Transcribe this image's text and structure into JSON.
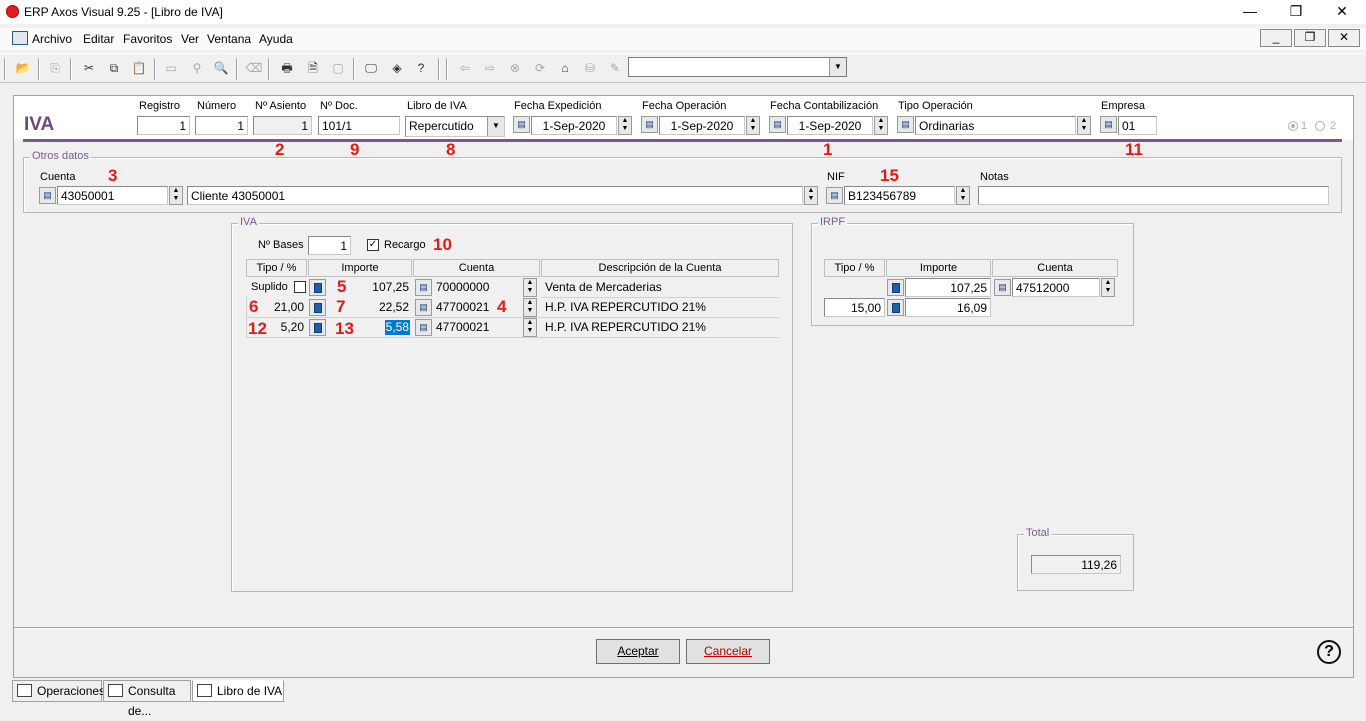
{
  "window": {
    "title": "ERP Axos Visual 9.25 - [Libro de IVA]"
  },
  "menu": [
    "Archivo",
    "Editar",
    "Favoritos",
    "Ver",
    "Ventana",
    "Ayuda"
  ],
  "form": {
    "title": "IVA",
    "registro": {
      "label": "Registro",
      "value": "1"
    },
    "numero": {
      "label": "Número",
      "value": "1"
    },
    "asiento": {
      "label": "Nº Asiento",
      "value": "1"
    },
    "doc": {
      "label": "Nº Doc.",
      "value": "101/1"
    },
    "libro": {
      "label": "Libro de IVA",
      "value": "Repercutido"
    },
    "fecha_exp": {
      "label": "Fecha Expedición",
      "value": "1-Sep-2020"
    },
    "fecha_op": {
      "label": "Fecha Operación",
      "value": "1-Sep-2020"
    },
    "fecha_cont": {
      "label": "Fecha Contabilización",
      "value": "1-Sep-2020"
    },
    "tipo_op": {
      "label": "Tipo Operación",
      "value": "Ordinarias"
    },
    "empresa": {
      "label": "Empresa",
      "value": "01"
    },
    "radio1": "1",
    "radio2": "2"
  },
  "otros": {
    "title": "Otros datos",
    "cuenta_label": "Cuenta",
    "cuenta": "43050001",
    "cliente": "Cliente 43050001",
    "nif_label": "NIF",
    "nif": "B123456789",
    "notas_label": "Notas",
    "notas": ""
  },
  "iva": {
    "title": "IVA",
    "bases_label": "Nº Bases",
    "bases": "1",
    "recargo_label": "Recargo",
    "headers": [
      "Tipo / %",
      "Importe",
      "Cuenta",
      "Descripción de la Cuenta"
    ],
    "suplido_label": "Suplido",
    "row0": {
      "importe": "107,25",
      "cuenta": "70000000",
      "desc": "Venta de Mercaderias"
    },
    "row1": {
      "tipo": "21,00",
      "importe": "22,52",
      "cuenta": "47700021",
      "desc": "H.P. IVA REPERCUTIDO 21%"
    },
    "row2": {
      "tipo": "5,20",
      "importe": "5,58",
      "cuenta": "47700021",
      "desc": "H.P. IVA REPERCUTIDO 21%"
    }
  },
  "irpf": {
    "title": "IRPF",
    "headers": [
      "Tipo / %",
      "Importe",
      "Cuenta"
    ],
    "row0": {
      "importe": "107,25",
      "cuenta": "47512000"
    },
    "row1": {
      "tipo": "15,00",
      "importe": "16,09"
    }
  },
  "total": {
    "title": "Total",
    "value": "119,26"
  },
  "buttons": {
    "aceptar": "Aceptar",
    "cancelar": "Cancelar"
  },
  "tabs": [
    "Operaciones",
    "Consulta de...",
    "Libro de IVA"
  ],
  "markers": {
    "m1": "1",
    "m2": "2",
    "m3": "3",
    "m4": "4",
    "m5": "5",
    "m6": "6",
    "m7": "7",
    "m8": "8",
    "m9": "9",
    "m10": "10",
    "m11": "11",
    "m12": "12",
    "m13": "13",
    "m15": "15"
  }
}
